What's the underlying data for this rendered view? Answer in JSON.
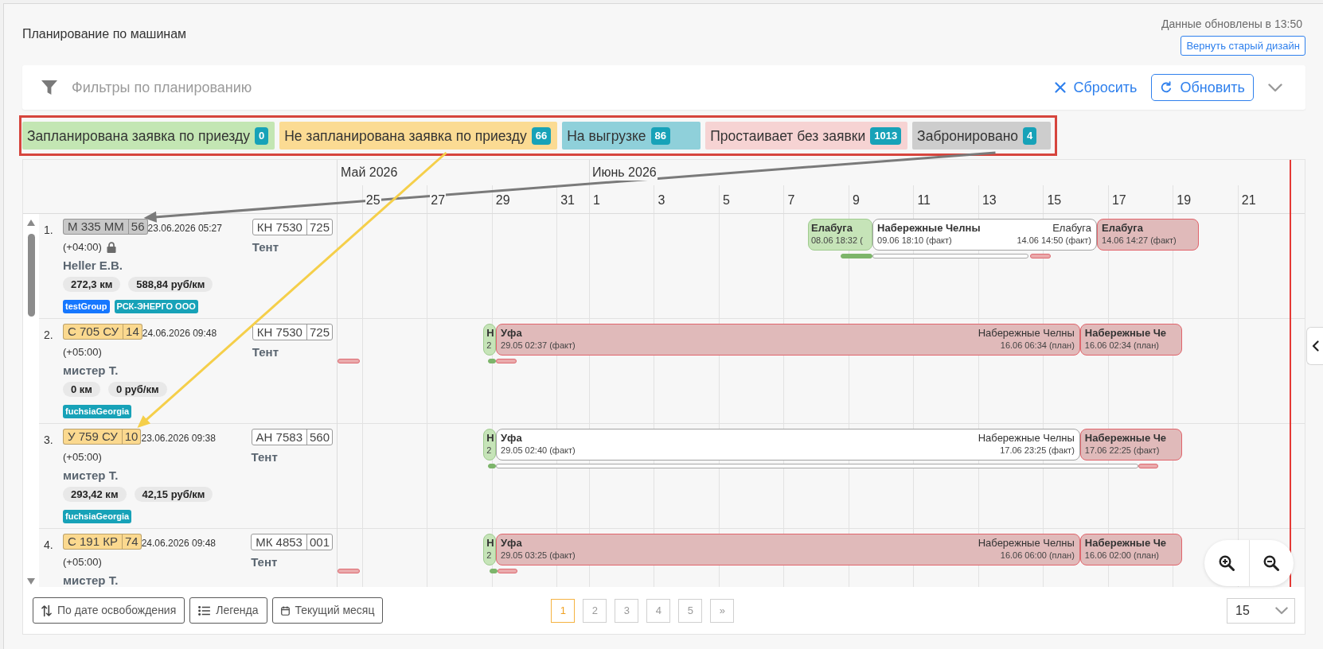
{
  "header": {
    "title": "Планирование по машинам",
    "updated": "Данные обновлены в 13:50",
    "old_design_button": "Вернуть старый дизайн"
  },
  "filters": {
    "title": "Фильтры по планированию",
    "reset": "Сбросить",
    "refresh": "Обновить",
    "expanded": false
  },
  "legend": {
    "highlighted": true,
    "items": [
      {
        "label": "Запланирована заявка по приезду",
        "count": "0",
        "color": "#c3e6b3"
      },
      {
        "label": "Не запланирована заявка по приезду",
        "count": "66",
        "color": "#fbdb93"
      },
      {
        "label": "На выгрузке",
        "count": "86",
        "color": "#8fd0da"
      },
      {
        "label": "Простаивает без заявки",
        "count": "1013",
        "color": "#f6d3d3"
      },
      {
        "label": "Забронировано",
        "count": "4",
        "color": "#cdcdcd"
      }
    ]
  },
  "timeline": {
    "months": [
      "Май 2026",
      "Июнь 2026"
    ],
    "days": [
      "25",
      "27",
      "29",
      "31",
      "1",
      "3",
      "5",
      "7",
      "9",
      "11",
      "13",
      "15",
      "17",
      "19",
      "21"
    ]
  },
  "rows": [
    {
      "number": "1.",
      "plate": {
        "number": "М 335 ММ",
        "region": "56",
        "color": "#c8c8c8"
      },
      "date": "23.06.2026 05:27",
      "timezone": "(+04:00)",
      "locked": true,
      "driver": "Heller E.B.",
      "stats": [
        "272,3 км",
        "588,84 руб/км"
      ],
      "tags": [
        {
          "label": "testGroup",
          "color": "#1677ff"
        },
        {
          "label": "РСК-ЭНЕРГО ООО",
          "color": "#17a2b8"
        }
      ],
      "trailer": {
        "number": "КН 7530",
        "region": "725"
      },
      "body_type": "Тент",
      "cards": [
        {
          "kind": "planned",
          "from": {
            "place": "Елабуга",
            "time": "08.06 18:32 ("
          }
        },
        {
          "kind": "trip",
          "from": {
            "place": "Набережные Челны",
            "time": "09.06 18:10 (факт)"
          },
          "to": {
            "place": "Елабуга",
            "time": "14.06 14:50 (факт)"
          }
        },
        {
          "kind": "idle",
          "from": {
            "place": "Елабуга",
            "time": "14.06 14:27 (факт)"
          }
        }
      ],
      "segments": [
        {
          "kind": "planned"
        },
        {
          "kind": "trip"
        },
        {
          "kind": "idle"
        }
      ]
    },
    {
      "number": "2.",
      "plate": {
        "number": "С 705 СУ",
        "region": "14",
        "color": "#fbd98f"
      },
      "date": "24.06.2026 09:48",
      "timezone": "(+05:00)",
      "locked": false,
      "driver": "мистер Т.",
      "stats": [
        "0 км",
        "0 руб/км"
      ],
      "tags": [
        {
          "label": "fuchsiaGeorgia",
          "color": "#17a2b8"
        }
      ],
      "trailer": {
        "number": "КН 7530",
        "region": "725"
      },
      "body_type": "Тент",
      "cards": [
        {
          "kind": "planned",
          "from": {
            "place": "Н",
            "time": "2"
          }
        },
        {
          "kind": "idle",
          "from": {
            "place": "Уфа",
            "time": "29.05 02:37 (факт)"
          },
          "to": {
            "place": "Набережные Челны",
            "time": "16.06 06:34 (план)"
          }
        },
        {
          "kind": "idle",
          "from": {
            "place": "Набережные Че",
            "time": "16.06 02:34 (план)"
          }
        }
      ],
      "segments": [
        {
          "kind": "idle"
        },
        {
          "kind": "planned"
        },
        {
          "kind": "idle"
        }
      ]
    },
    {
      "number": "3.",
      "plate": {
        "number": "У 759 СУ",
        "region": "10",
        "color": "#fbd98f"
      },
      "date": "23.06.2026 09:38",
      "timezone": "(+05:00)",
      "locked": false,
      "driver": "мистер Т.",
      "stats": [
        "293,42 км",
        "42,15 руб/км"
      ],
      "tags": [
        {
          "label": "fuchsiaGeorgia",
          "color": "#17a2b8"
        }
      ],
      "trailer": {
        "number": "АН 7583",
        "region": "560"
      },
      "body_type": "Тент",
      "cards": [
        {
          "kind": "planned",
          "from": {
            "place": "Н",
            "time": "2"
          }
        },
        {
          "kind": "trip",
          "from": {
            "place": "Уфа",
            "time": "29.05 02:40 (факт)"
          },
          "to": {
            "place": "Набережные Челны",
            "time": "17.06 23:25 (факт)"
          }
        },
        {
          "kind": "idle",
          "from": {
            "place": "Набережные Че",
            "time": "17.06 22:25 (факт)"
          }
        }
      ],
      "segments": [
        {
          "kind": "planned"
        },
        {
          "kind": "trip"
        },
        {
          "kind": "idle"
        }
      ]
    },
    {
      "number": "4.",
      "plate": {
        "number": "С 191 КР",
        "region": "74",
        "color": "#fbd98f"
      },
      "date": "24.06.2026 09:48",
      "timezone": "(+05:00)",
      "locked": false,
      "driver": "мистер Т.",
      "trailer": {
        "number": "МК 4853",
        "region": "001"
      },
      "body_type": "Тент",
      "cards": [
        {
          "kind": "planned",
          "from": {
            "place": "Н",
            "time": "2"
          }
        },
        {
          "kind": "idle",
          "from": {
            "place": "Уфа",
            "time": "29.05 03:25 (факт)"
          },
          "to": {
            "place": "Набережные Челны",
            "time": "16.06 06:00 (план)"
          }
        },
        {
          "kind": "idle",
          "from": {
            "place": "Набережные Че",
            "time": "16.06 02:00 (план)"
          }
        }
      ],
      "segments": [
        {
          "kind": "idle"
        },
        {
          "kind": "planned"
        },
        {
          "kind": "idle"
        }
      ]
    }
  ],
  "toolbar": {
    "buttons": [
      {
        "kind": "sort",
        "label": "По дате освобождения"
      },
      {
        "kind": "legend",
        "label": "Легенда"
      },
      {
        "kind": "calendar",
        "label": "Текущий месяц"
      }
    ]
  },
  "pagination": {
    "pages": [
      {
        "label": "1",
        "selected": true
      },
      {
        "label": "2",
        "selected": false
      },
      {
        "label": "3",
        "selected": false
      },
      {
        "label": "4",
        "selected": false
      },
      {
        "label": "5",
        "selected": false
      },
      {
        "label": "»",
        "selected": false
      }
    ],
    "page_size": "15"
  },
  "annotations": [
    {
      "kind": "arrow",
      "color": "#7a7a7a"
    },
    {
      "kind": "arrow",
      "color": "#f5cf4a"
    }
  ]
}
